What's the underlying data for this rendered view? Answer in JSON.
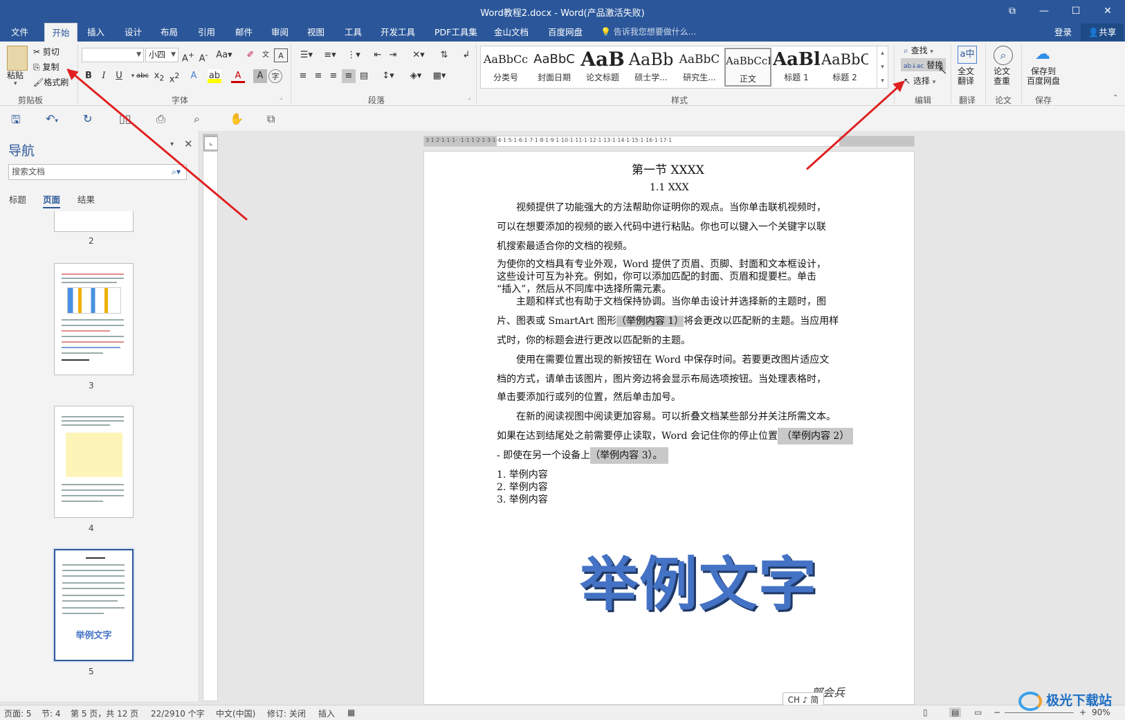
{
  "window": {
    "title": "Word教程2.docx - Word(产品激活失败)"
  },
  "tabs": [
    "文件",
    "开始",
    "插入",
    "设计",
    "布局",
    "引用",
    "邮件",
    "审阅",
    "视图",
    "工具",
    "开发工具",
    "PDF工具集",
    "金山文档",
    "百度网盘"
  ],
  "tell_me": "告诉我您想要做什么...",
  "login": "登录",
  "share": "共享",
  "clipboard": {
    "paste": "粘贴",
    "cut": "剪切",
    "copy": "复制",
    "format_painter": "格式刷",
    "label": "剪贴板"
  },
  "font": {
    "name": "",
    "size": "小四",
    "label": "字体"
  },
  "paragraph": {
    "label": "段落"
  },
  "styles": {
    "items": [
      {
        "preview": "AaBbCc",
        "name": "分类号"
      },
      {
        "preview": "AaBbC",
        "name": "封面日期"
      },
      {
        "preview": "AaB",
        "name": "论文标题"
      },
      {
        "preview": "AaBb",
        "name": "硕士学..."
      },
      {
        "preview": "AaBbC",
        "name": "研究生..."
      },
      {
        "preview": "AaBbCcI",
        "name": "正文"
      },
      {
        "preview": "AaBl",
        "name": "标题 1"
      },
      {
        "preview": "AaBbC",
        "name": "标题 2"
      }
    ],
    "label": "样式"
  },
  "editing": {
    "find": "查找",
    "replace": "替换",
    "select": "选择",
    "label": "编辑"
  },
  "translate": {
    "button": "全文\n翻译",
    "label": "翻译"
  },
  "paper": {
    "button": "论文\n查重",
    "label": "论文"
  },
  "save": {
    "button": "保存到\n百度网盘",
    "label": "保存"
  },
  "nav": {
    "title": "导航",
    "search_placeholder": "搜索文档",
    "tabs": [
      "标题",
      "页面",
      "结果"
    ],
    "pages": [
      "2",
      "3",
      "4",
      "5"
    ],
    "thumb5_text": "举例文字"
  },
  "document": {
    "heading": "第一节  XXXX",
    "subheading": "1.1 XXX",
    "lines": [
      "视频提供了功能强大的方法帮助你证明你的观点。当你单击联机视频时，",
      "可以在想要添加的视频的嵌入代码中进行粘贴。你也可以键入一个关键字以联",
      "机搜索最适合你的文档的视频。",
      "为使你的文档具有专业外观，Word 提供了页眉、页脚、封面和文本框设计，",
      "这些设计可互为补充。例如，你可以添加匹配的封面、页眉和提要栏。单击",
      "“插入”，然后从不同库中选择所需元素。",
      "主题和样式也有助于文档保持协调。当你单击设计并选择新的主题时，图",
      "片、图表或 SmartArt 图形",
      "（举例内容 1）",
      "将会更改以匹配新的主题。当应用样",
      "式时，你的标题会进行更改以匹配新的主题。",
      "使用在需要位置出现的新按钮在 Word 中保存时间。若要更改图片适应文",
      "档的方式，请单击该图片，图片旁边将会显示布局选项按钮。当处理表格时，",
      "单击要添加行或列的位置，然后单击加号。",
      "在新的阅读视图中阅读更加容易。可以折叠文档某些部分并关注所需文本。",
      "如果在达到结尾处之前需要停止读取，Word 会记住你的停止位置",
      "（举例内容 2）",
      "- 即使在另一个设备上",
      "（举例内容 3）。",
      "1. 举例内容",
      "2. 举例内容",
      "3. 举例内容"
    ],
    "big_text": "举例文字",
    "signature": "郭会兵"
  },
  "ime": "CH ♪ 简",
  "status": {
    "page": "页面: 5",
    "section": "节: 4",
    "pages": "第 5 页，共 12 页",
    "words": "22/2910 个字",
    "lang": "中文(中国)",
    "track": "修订: 关闭",
    "insert": "插入",
    "zoom": "90%"
  },
  "watermark": "极光下载站",
  "ruler_ticks": "3·1·2·1·1·1· ·1·1·1·2·1·3·1·4·1·5·1·6·1·7·1·8·1·9·1·10·1·11·1·12·1·13·1·14·1·15·1·16·1·17·1"
}
